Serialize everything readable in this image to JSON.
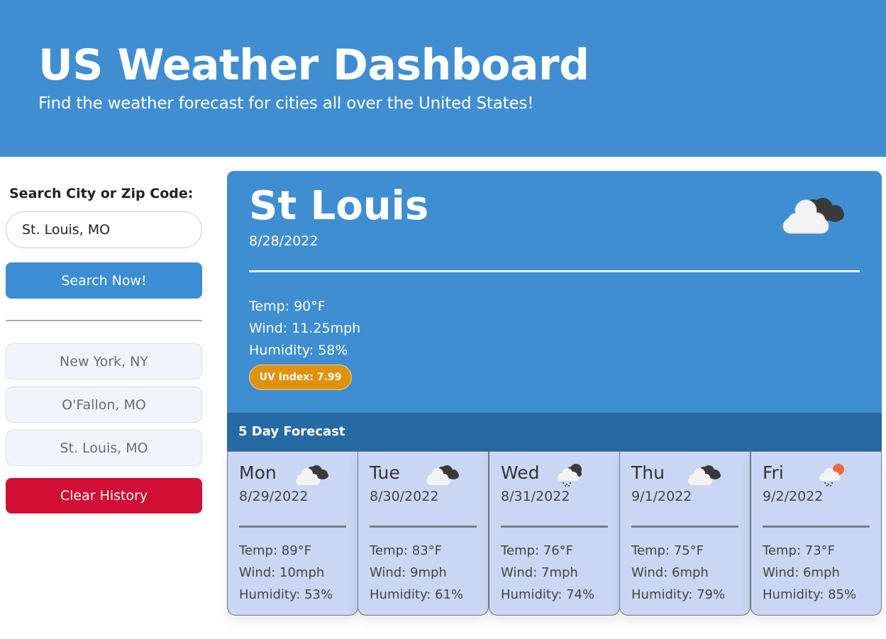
{
  "header": {
    "title": "US Weather Dashboard",
    "subtitle": "Find the weather forecast for cities all over the United States!"
  },
  "search": {
    "label": "Search City or Zip Code:",
    "value": "St. Louis, MO",
    "button_label": "Search Now!"
  },
  "history": {
    "items": [
      "New York, NY",
      "O'Fallon, MO",
      "St. Louis, MO"
    ],
    "clear_label": "Clear History"
  },
  "current": {
    "city": "St Louis",
    "date": "8/28/2022",
    "icon": "cloudy-icon",
    "temp": "Temp: 90°F",
    "wind": "Wind: 11.25mph",
    "humidity": "Humidity: 58%",
    "uv": "UV Index: 7.99",
    "uv_color": "#e0920f"
  },
  "forecast": {
    "title": "5 Day Forecast",
    "days": [
      {
        "day": "Mon",
        "date": "8/29/2022",
        "icon": "cloudy-icon",
        "temp": "Temp: 89°F",
        "wind": "Wind: 10mph",
        "humidity": "Humidity: 53%"
      },
      {
        "day": "Tue",
        "date": "8/30/2022",
        "icon": "cloudy-icon",
        "temp": "Temp: 83°F",
        "wind": "Wind: 9mph",
        "humidity": "Humidity: 61%"
      },
      {
        "day": "Wed",
        "date": "8/31/2022",
        "icon": "rain-cloud-icon",
        "temp": "Temp: 76°F",
        "wind": "Wind: 7mph",
        "humidity": "Humidity: 74%"
      },
      {
        "day": "Thu",
        "date": "9/1/2022",
        "icon": "cloudy-icon",
        "temp": "Temp: 75°F",
        "wind": "Wind: 6mph",
        "humidity": "Humidity: 79%"
      },
      {
        "day": "Fri",
        "date": "9/2/2022",
        "icon": "sun-rain-cloud-icon",
        "temp": "Temp: 73°F",
        "wind": "Wind: 6mph",
        "humidity": "Humidity: 85%"
      }
    ]
  },
  "colors": {
    "header_bg": "#408ed1",
    "forecast_header_bg": "#256aa3",
    "card_bg": "#cbd6f5",
    "clear_button": "#d10e34"
  }
}
